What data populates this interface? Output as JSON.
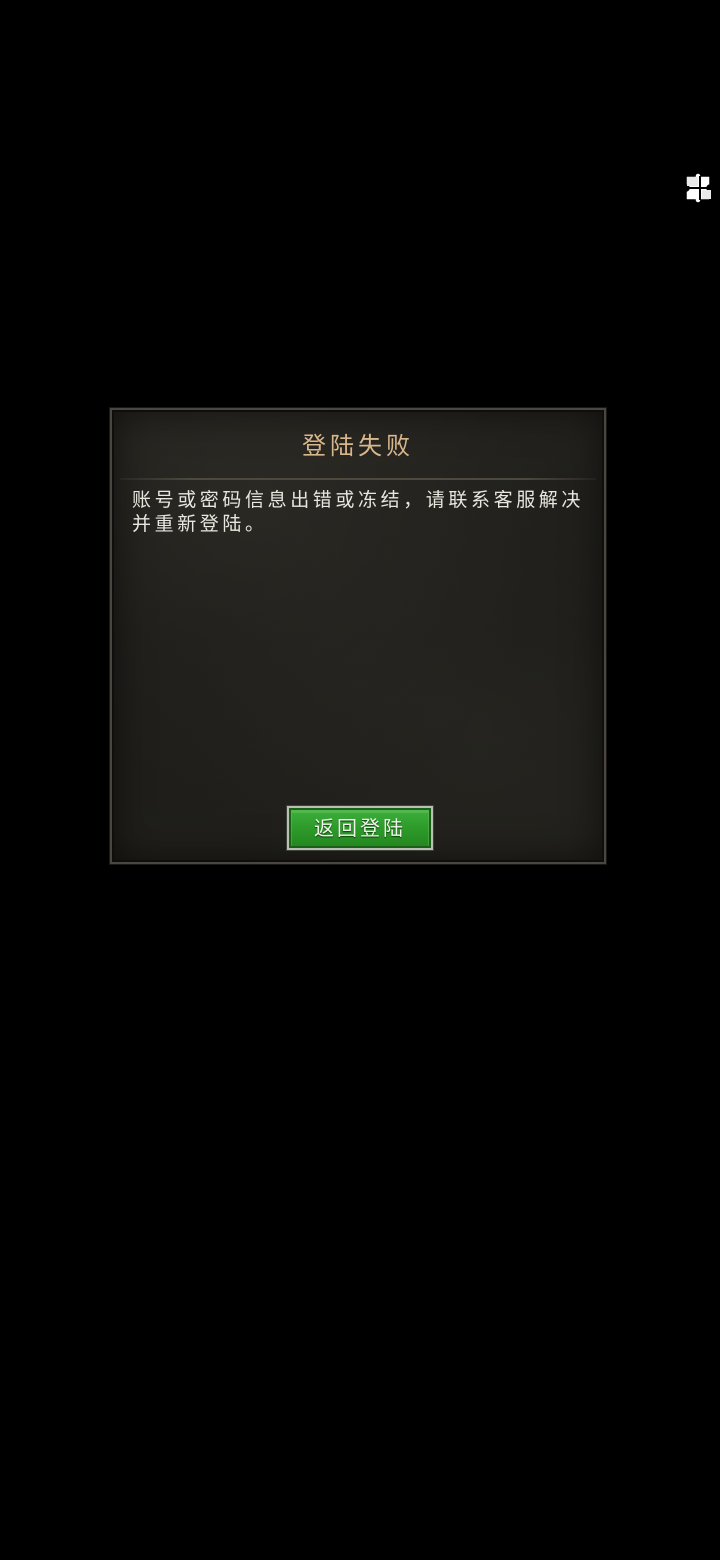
{
  "floating": {
    "icon": "puzzle-icon"
  },
  "dialog": {
    "title": "登陆失败",
    "message": "账号或密码信息出错或冻结，请联系客服解决并重新登陆。",
    "button_label": "返回登陆"
  },
  "colors": {
    "background": "#000000",
    "dialog_bg": "#1f1e1b",
    "title": "#d9b78c",
    "message": "#e9e6df",
    "button_green": "#2f9d2c"
  }
}
